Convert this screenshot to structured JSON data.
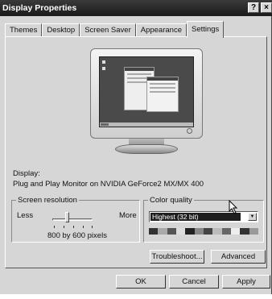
{
  "window": {
    "title": "Display Properties"
  },
  "title_buttons": {
    "help": "?",
    "close": "×"
  },
  "tabs": [
    {
      "label": "Themes",
      "active": false
    },
    {
      "label": "Desktop",
      "active": false
    },
    {
      "label": "Screen Saver",
      "active": false
    },
    {
      "label": "Appearance",
      "active": false
    },
    {
      "label": "Settings",
      "active": true
    }
  ],
  "display": {
    "label": "Display:",
    "value": "Plug and Play Monitor on NVIDIA GeForce2 MX/MX 400"
  },
  "screen_resolution": {
    "legend": "Screen resolution",
    "less": "Less",
    "more": "More",
    "value": "800 by 600 pixels",
    "slider_position": 0.3
  },
  "color_quality": {
    "legend": "Color quality",
    "selected": "Highest (32 bit)"
  },
  "buttons": {
    "troubleshoot": "Troubleshoot...",
    "advanced": "Advanced",
    "ok": "OK",
    "cancel": "Cancel",
    "apply": "Apply"
  },
  "colors": {
    "dialog_bg": "#d6d6d6",
    "titlebar": "#1a1a1a",
    "selection": "#1e1e1e"
  }
}
